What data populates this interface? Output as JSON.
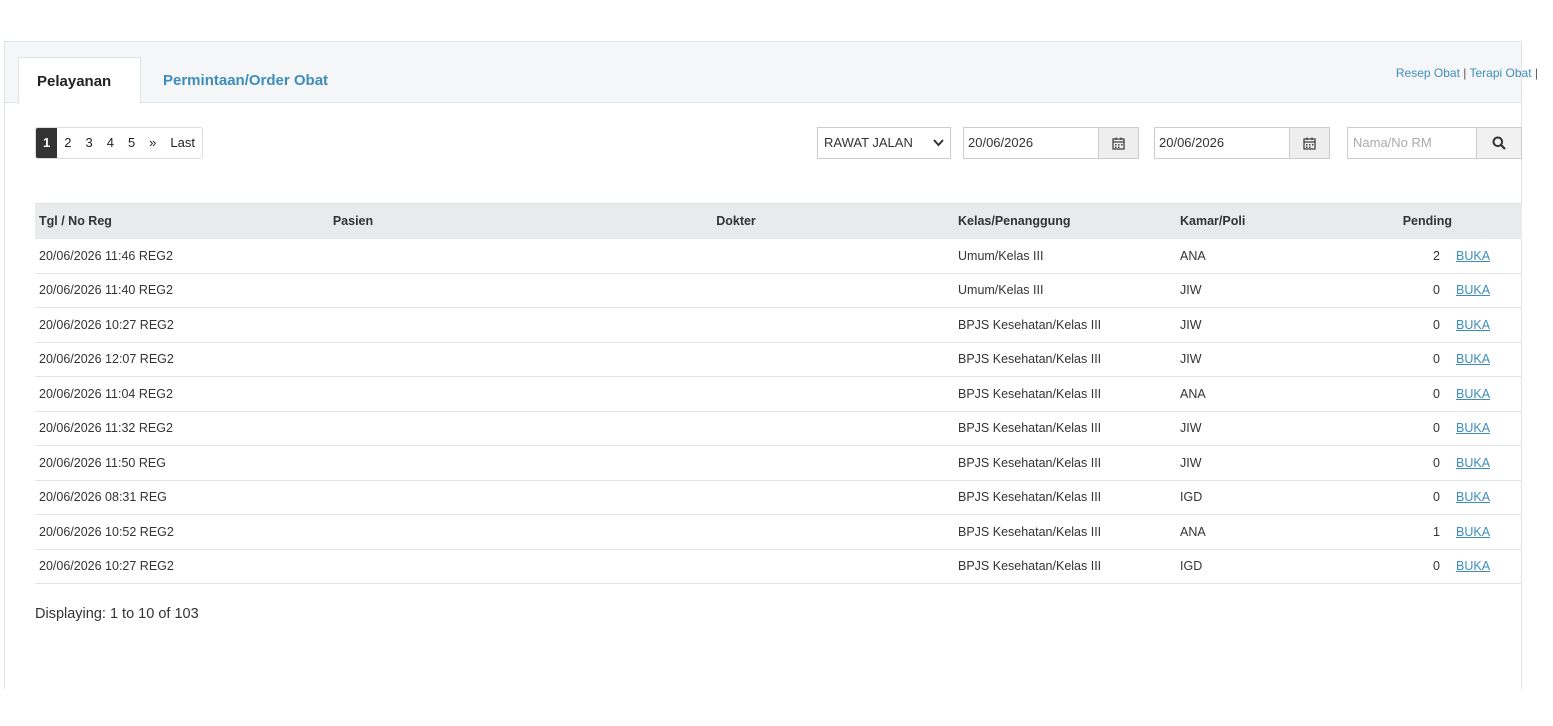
{
  "tabs": {
    "active": "Pelayanan",
    "inactive": "Permintaan/Order Obat"
  },
  "top_links": {
    "resep": "Resep Obat",
    "sep1": " | ",
    "terapi": "Terapi Obat",
    "sep2": " |"
  },
  "pager": [
    "1",
    "2",
    "3",
    "4",
    "5",
    "»",
    "Last"
  ],
  "filters": {
    "jenis": "RAWAT JALAN",
    "date_from": "20/06/2026",
    "date_to": "20/06/2026",
    "search_placeholder": "Nama/No RM"
  },
  "table": {
    "headers": {
      "tgl": "Tgl / No Reg",
      "pasien": "Pasien",
      "dokter": "Dokter",
      "kelas": "Kelas/Penanggung",
      "kamar": "Kamar/Poli",
      "pending": "Pending"
    },
    "rows": [
      {
        "tgl": "20/06/2026 11:46 REG2",
        "pasien": "",
        "dokter": "",
        "kelas": "Umum/Kelas III",
        "kamar": "ANA",
        "pending": "2",
        "action": "BUKA"
      },
      {
        "tgl": "20/06/2026 11:40 REG2",
        "pasien": "",
        "dokter": "",
        "kelas": "Umum/Kelas III",
        "kamar": "JIW",
        "pending": "0",
        "action": "BUKA"
      },
      {
        "tgl": "20/06/2026 10:27 REG2",
        "pasien": "",
        "dokter": "",
        "kelas": "BPJS Kesehatan/Kelas III",
        "kamar": "JIW",
        "pending": "0",
        "action": "BUKA"
      },
      {
        "tgl": "20/06/2026 12:07 REG2",
        "pasien": "",
        "dokter": "",
        "kelas": "BPJS Kesehatan/Kelas III",
        "kamar": "JIW",
        "pending": "0",
        "action": "BUKA"
      },
      {
        "tgl": "20/06/2026 11:04 REG2",
        "pasien": "",
        "dokter": "",
        "kelas": "BPJS Kesehatan/Kelas III",
        "kamar": "ANA",
        "pending": "0",
        "action": "BUKA"
      },
      {
        "tgl": "20/06/2026 11:32 REG2",
        "pasien": "",
        "dokter": "",
        "kelas": "BPJS Kesehatan/Kelas III",
        "kamar": "JIW",
        "pending": "0",
        "action": "BUKA"
      },
      {
        "tgl": "20/06/2026 11:50 REG",
        "pasien": "",
        "dokter": "",
        "kelas": "BPJS Kesehatan/Kelas III",
        "kamar": "JIW",
        "pending": "0",
        "action": "BUKA"
      },
      {
        "tgl": "20/06/2026 08:31 REG",
        "pasien": "",
        "dokter": "",
        "kelas": "BPJS Kesehatan/Kelas III",
        "kamar": "IGD",
        "pending": "0",
        "action": "BUKA"
      },
      {
        "tgl": "20/06/2026 10:52 REG2",
        "pasien": "",
        "dokter": "",
        "kelas": "BPJS Kesehatan/Kelas III",
        "kamar": "ANA",
        "pending": "1",
        "action": "BUKA"
      },
      {
        "tgl": "20/06/2026 10:27 REG2",
        "pasien": "",
        "dokter": "",
        "kelas": "BPJS Kesehatan/Kelas III",
        "kamar": "IGD",
        "pending": "0",
        "action": "BUKA"
      }
    ]
  },
  "footer": "Displaying: 1 to 10 of 103",
  "icons": {
    "calendar": "calendar-icon",
    "search": "search-icon",
    "chevron": "chevron-down-icon"
  },
  "colors": {
    "link": "#3c8dbc",
    "active_page": "#333333",
    "header_bg": "#e8eaeb"
  }
}
